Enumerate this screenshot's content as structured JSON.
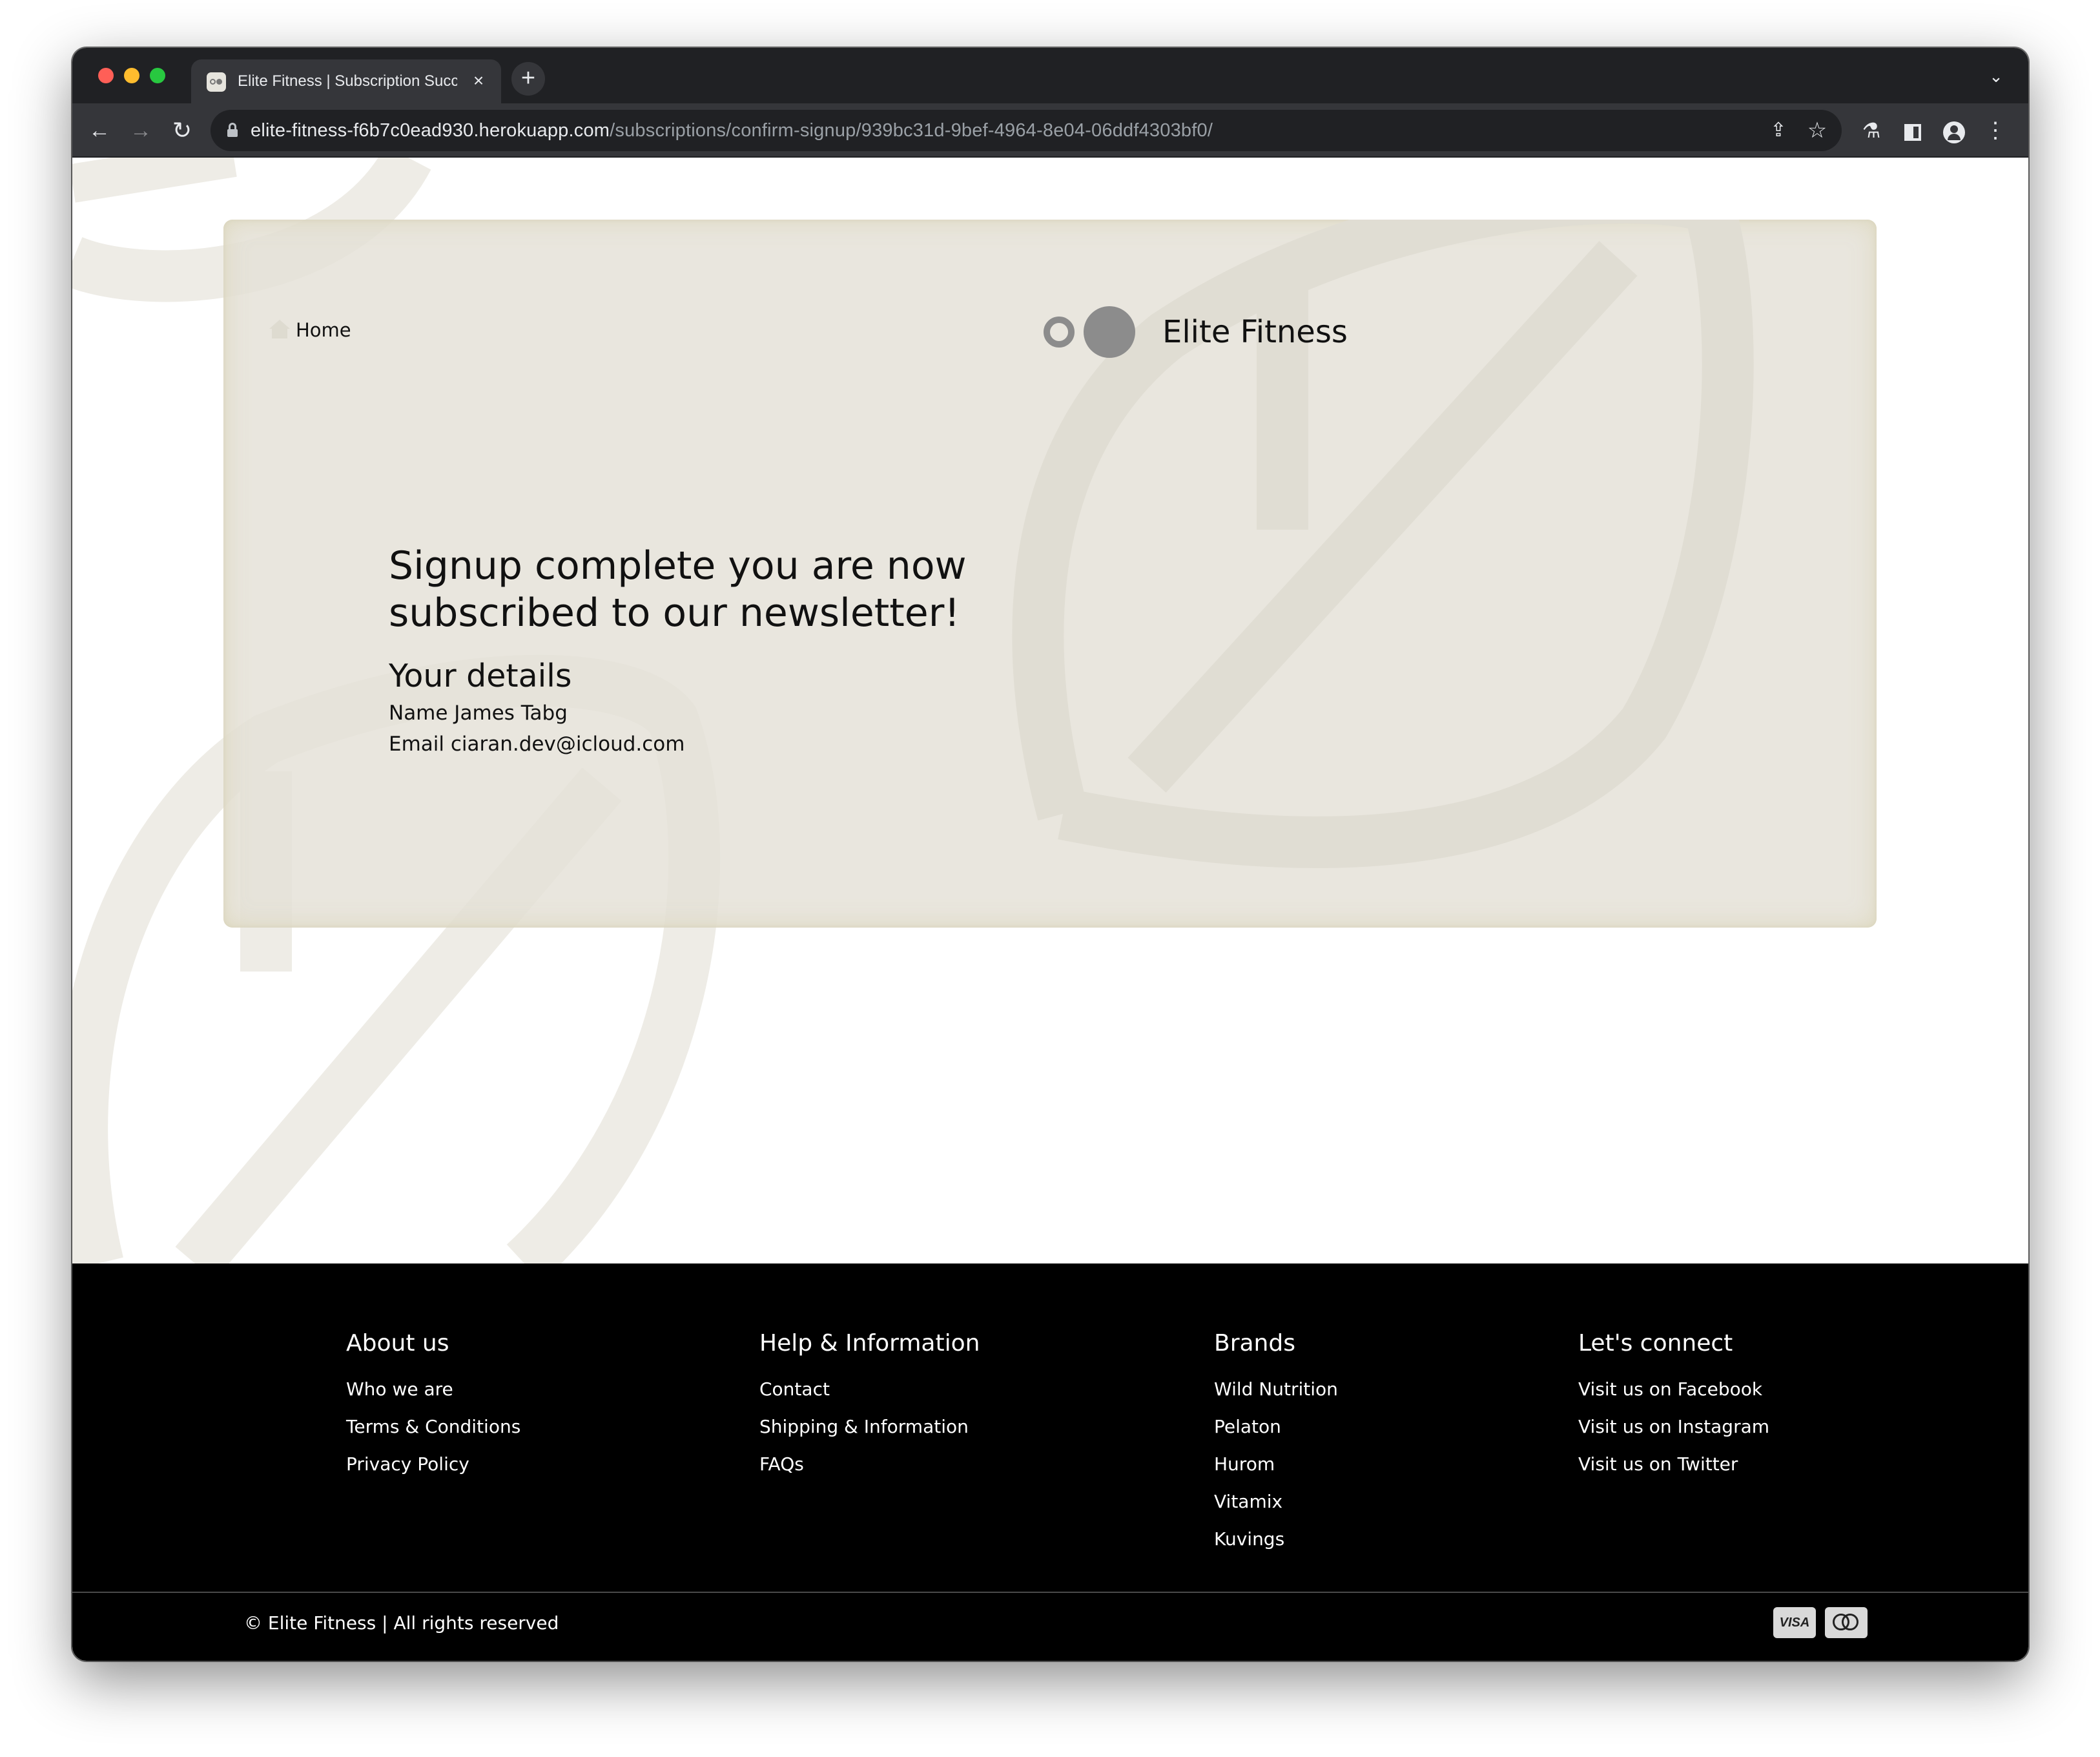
{
  "browser": {
    "tab_title": "Elite Fitness | Subscription Success",
    "url_host": "elite-fitness-f6b7c0ead930.herokuapp.com",
    "url_path": "/subscriptions/confirm-signup/939bc31d-9bef-4964-8e04-06ddf4303bf0/",
    "icons": [
      "back-arrow-icon",
      "forward-arrow-icon",
      "reload-icon",
      "lock-icon",
      "share-icon",
      "star-icon",
      "labs-icon",
      "side-panel-icon",
      "profile-icon",
      "menu-icon",
      "new-tab-icon",
      "close-icon",
      "tab-search-icon"
    ]
  },
  "header": {
    "home_label": "Home",
    "brand_name": "Elite Fitness"
  },
  "confirmation": {
    "title": "Signup complete you are now subscribed to our newsletter!",
    "details_heading": "Your details",
    "name_line": "Name James Tabg",
    "email_line": "Email ciaran.dev@icloud.com"
  },
  "footer": {
    "about": {
      "heading": "About us",
      "links": [
        "Who we are",
        "Terms & Conditions",
        "Privacy Policy"
      ]
    },
    "help": {
      "heading": "Help & Information",
      "links": [
        "Contact",
        "Shipping & Information",
        "FAQs"
      ]
    },
    "brands": {
      "heading": "Brands",
      "links": [
        "Wild Nutrition",
        "Pelaton",
        "Hurom",
        "Vitamix",
        "Kuvings"
      ]
    },
    "connect": {
      "heading": "Let's connect",
      "links": [
        "Visit us on Facebook",
        "Visit us on Instagram",
        "Visit us on Twitter"
      ]
    },
    "copyright": "© Elite Fitness | All rights reserved",
    "payment_icons": [
      "visa-icon",
      "mastercard-icon"
    ],
    "visa_text": "VISA"
  },
  "colors": {
    "card_background": "#e4e1d7",
    "footer_background": "#000000",
    "logo_grey": "#8c8c8c",
    "watermark": "#eeece6"
  }
}
